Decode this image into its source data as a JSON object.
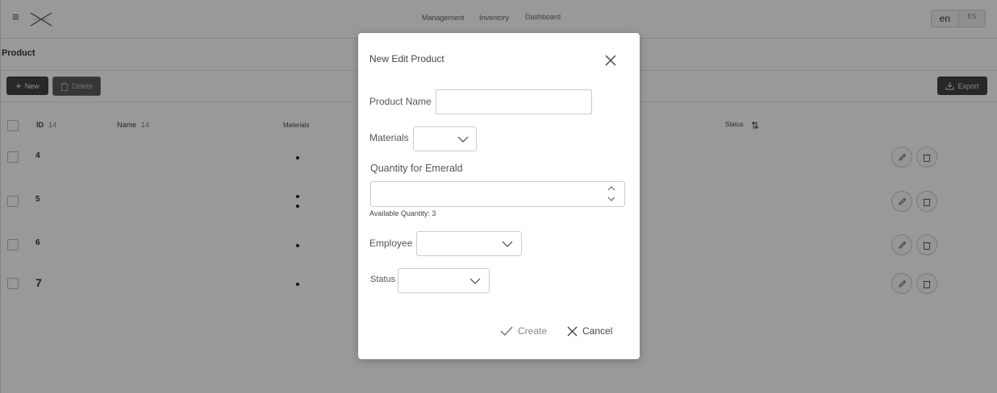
{
  "header": {
    "nav": [
      "Management",
      "Inventory",
      "Dashboard"
    ],
    "lang_active": "en",
    "lang_other": "ES"
  },
  "page": {
    "section_title": "Product",
    "toolbar": {
      "new_label": "New",
      "delete_label": "Delete",
      "export_label": "Export"
    }
  },
  "table": {
    "headers": {
      "id": "ID",
      "id_count": "14",
      "name": "Name",
      "name_count": "14",
      "materials": "Materials",
      "status": "Status"
    },
    "rows": [
      {
        "id": "4",
        "material_dots": 1
      },
      {
        "id": "5",
        "material_dots": 2
      },
      {
        "id": "6",
        "material_dots": 1
      },
      {
        "id": "7",
        "material_dots": 1
      }
    ]
  },
  "dialog": {
    "title": "New Edit Product",
    "product_name_label": "Product Name",
    "product_name_value": "",
    "materials_label": "Materials",
    "quantity_label": "Quantity for Emerald",
    "quantity_value": "",
    "available_quantity": "Available Quantity: 3",
    "employee_label": "Employee",
    "status_label": "Status",
    "create_label": "Create",
    "cancel_label": "Cancel"
  },
  "colors": {
    "overlay": "#000000",
    "dialog_bg": "#ffffff",
    "toolbar_button": "#444444"
  }
}
